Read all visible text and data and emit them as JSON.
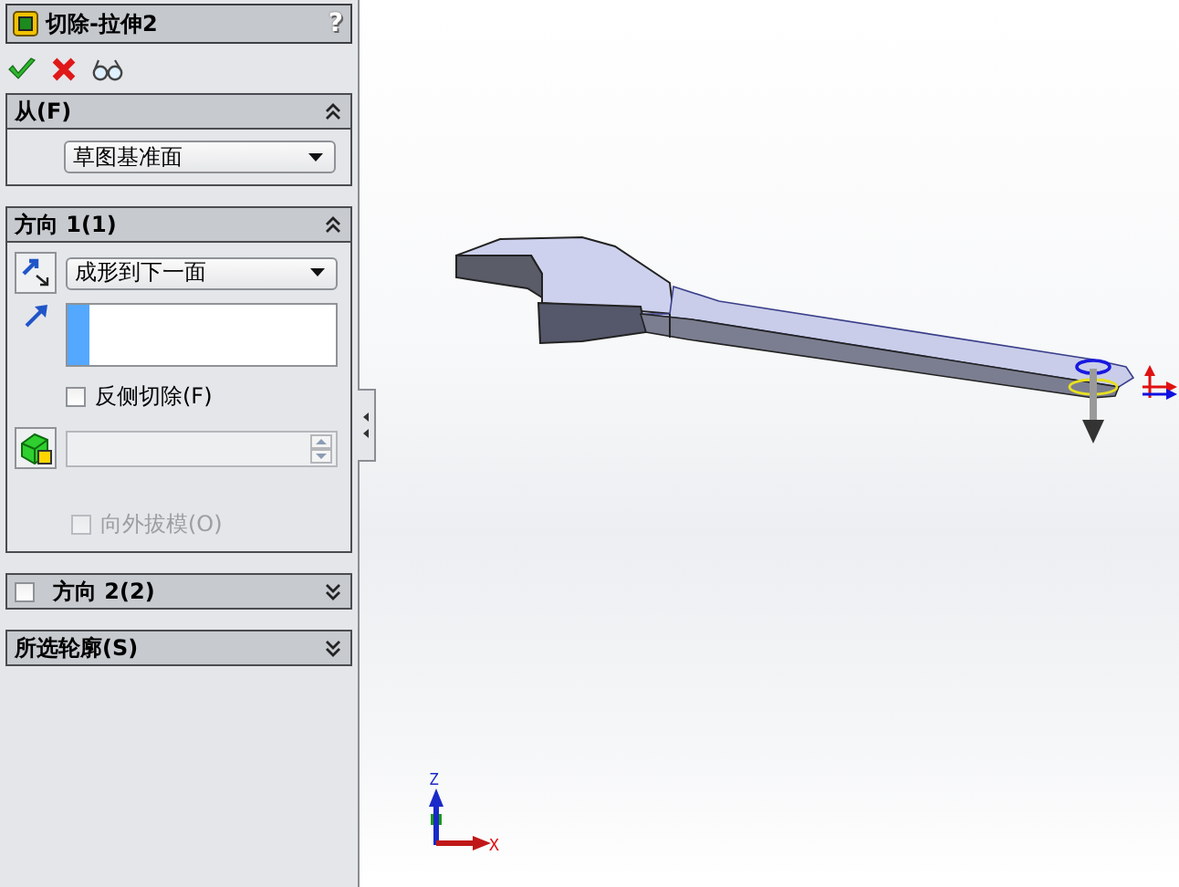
{
  "property_manager": {
    "title": "切除-拉伸2",
    "help": "?",
    "sections": [
      {
        "kind": "from",
        "title": "从(F)",
        "expanded": true,
        "dropdown": "草图基准面"
      },
      {
        "kind": "direction",
        "title": "方向 1(1)",
        "expanded": true,
        "dropdown": "成形到下一面",
        "reverse_cut": {
          "label": "反侧切除(F)",
          "checked": false
        },
        "draft": {
          "label": "向外拔模(O)",
          "checked": false,
          "disabled": true
        }
      },
      {
        "kind": "toggle",
        "title": "方向 2(2)",
        "expanded": false,
        "checked": false
      },
      {
        "kind": "plain",
        "title": "所选轮廓(S)",
        "expanded": false
      }
    ]
  },
  "viewport": {
    "triad": {
      "z_label": "Z",
      "x_label": "X"
    }
  }
}
